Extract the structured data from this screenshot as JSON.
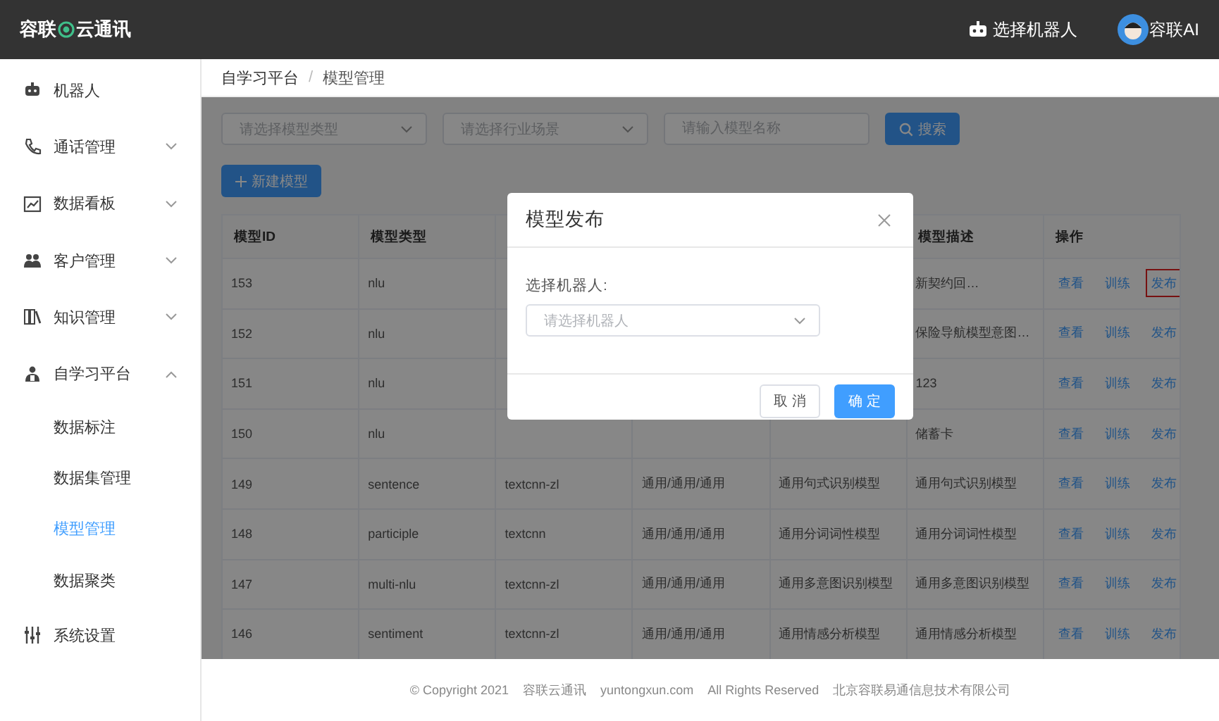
{
  "header": {
    "logo_left": "容联",
    "logo_right": "云通讯",
    "robot_select": "选择机器人",
    "user": "容联AI"
  },
  "sidebar": {
    "items": [
      {
        "label": "机器人"
      },
      {
        "label": "通话管理",
        "expanded": false
      },
      {
        "label": "数据看板",
        "expanded": false
      },
      {
        "label": "客户管理",
        "expanded": false
      },
      {
        "label": "知识管理",
        "expanded": false
      },
      {
        "label": "自学习平台",
        "expanded": true,
        "children": [
          {
            "label": "数据标注",
            "selected": false
          },
          {
            "label": "数据集管理",
            "selected": false
          },
          {
            "label": "模型管理",
            "selected": true
          },
          {
            "label": "数据聚类",
            "selected": false
          }
        ]
      },
      {
        "label": "系统设置"
      }
    ]
  },
  "breadcrumb": [
    "自学习平台",
    "模型管理"
  ],
  "breadcrumb_separator": "/",
  "filters": {
    "model_type": {
      "placeholder": "请选择模型类型"
    },
    "industry": {
      "placeholder": "请选择行业场景"
    },
    "name": {
      "placeholder": "请输入模型名称"
    },
    "search_button": "搜索"
  },
  "new_button": "新建模型",
  "table": {
    "columns": [
      "模型ID",
      "模型类型",
      "",
      "",
      "",
      "模型描述",
      "操作"
    ],
    "rows": [
      {
        "model_id": "153",
        "model_type": "nlu",
        "description": "新契约回…",
        "actions": [
          {
            "label": "查看",
            "highlighted": false
          },
          {
            "label": "训练",
            "highlighted": false
          },
          {
            "label": "发布",
            "highlighted": true
          }
        ]
      },
      {
        "model_id": "152",
        "model_type": "nlu",
        "description": "保险导航模型意图…",
        "actions": [
          {
            "label": "查看",
            "highlighted": false
          },
          {
            "label": "训练",
            "highlighted": false
          },
          {
            "label": "发布",
            "highlighted": false
          }
        ]
      },
      {
        "model_id": "151",
        "model_type": "nlu",
        "description": "123",
        "actions": [
          {
            "label": "查看",
            "highlighted": false
          },
          {
            "label": "训练",
            "highlighted": false
          },
          {
            "label": "发布",
            "highlighted": false
          }
        ]
      },
      {
        "model_id": "150",
        "model_type": "nlu",
        "description": "储蓄卡",
        "actions": [
          {
            "label": "查看",
            "highlighted": false
          },
          {
            "label": "训练",
            "highlighted": false
          },
          {
            "label": "发布",
            "highlighted": false
          }
        ]
      },
      {
        "model_id": "149",
        "model_type": "sentence",
        "column_3": "textcnn-zl",
        "column_4": "通用/通用/通用",
        "column_5": "通用句式识别模型",
        "description": "通用句式识别模型",
        "actions": [
          {
            "label": "查看",
            "highlighted": false
          },
          {
            "label": "训练",
            "highlighted": false
          },
          {
            "label": "发布",
            "highlighted": false
          }
        ]
      },
      {
        "model_id": "148",
        "model_type": "participle",
        "column_3": "textcnn",
        "column_4": "通用/通用/通用",
        "column_5": "通用分词词性模型",
        "description": "通用分词词性模型",
        "actions": [
          {
            "label": "查看",
            "highlighted": false
          },
          {
            "label": "训练",
            "highlighted": false
          },
          {
            "label": "发布",
            "highlighted": false
          }
        ]
      },
      {
        "model_id": "147",
        "model_type": "multi-nlu",
        "column_3": "textcnn-zl",
        "column_4": "通用/通用/通用",
        "column_5": "通用多意图识别模型",
        "description": "通用多意图识别模型",
        "actions": [
          {
            "label": "查看",
            "highlighted": false
          },
          {
            "label": "训练",
            "highlighted": false
          },
          {
            "label": "发布",
            "highlighted": false
          }
        ]
      },
      {
        "model_id": "146",
        "model_type": "sentiment",
        "column_3": "textcnn-zl",
        "column_4": "通用/通用/通用",
        "column_5": "通用情感分析模型",
        "description": "通用情感分析模型",
        "actions": [
          {
            "label": "查看",
            "highlighted": false
          },
          {
            "label": "训练",
            "highlighted": false
          },
          {
            "label": "发布",
            "highlighted": false
          }
        ]
      }
    ]
  },
  "footer": [
    "© Copyright 2021",
    "容联云通讯",
    "yuntongxun.com",
    "All Rights Reserved",
    "北京容联易通信息技术有限公司"
  ],
  "modal": {
    "title": "模型发布",
    "field_label": "选择机器人:",
    "select": {
      "placeholder": "请选择机器人"
    },
    "buttons": [
      {
        "label": "取 消",
        "kind": "secondary"
      },
      {
        "label": "确 定",
        "kind": "primary"
      }
    ]
  }
}
